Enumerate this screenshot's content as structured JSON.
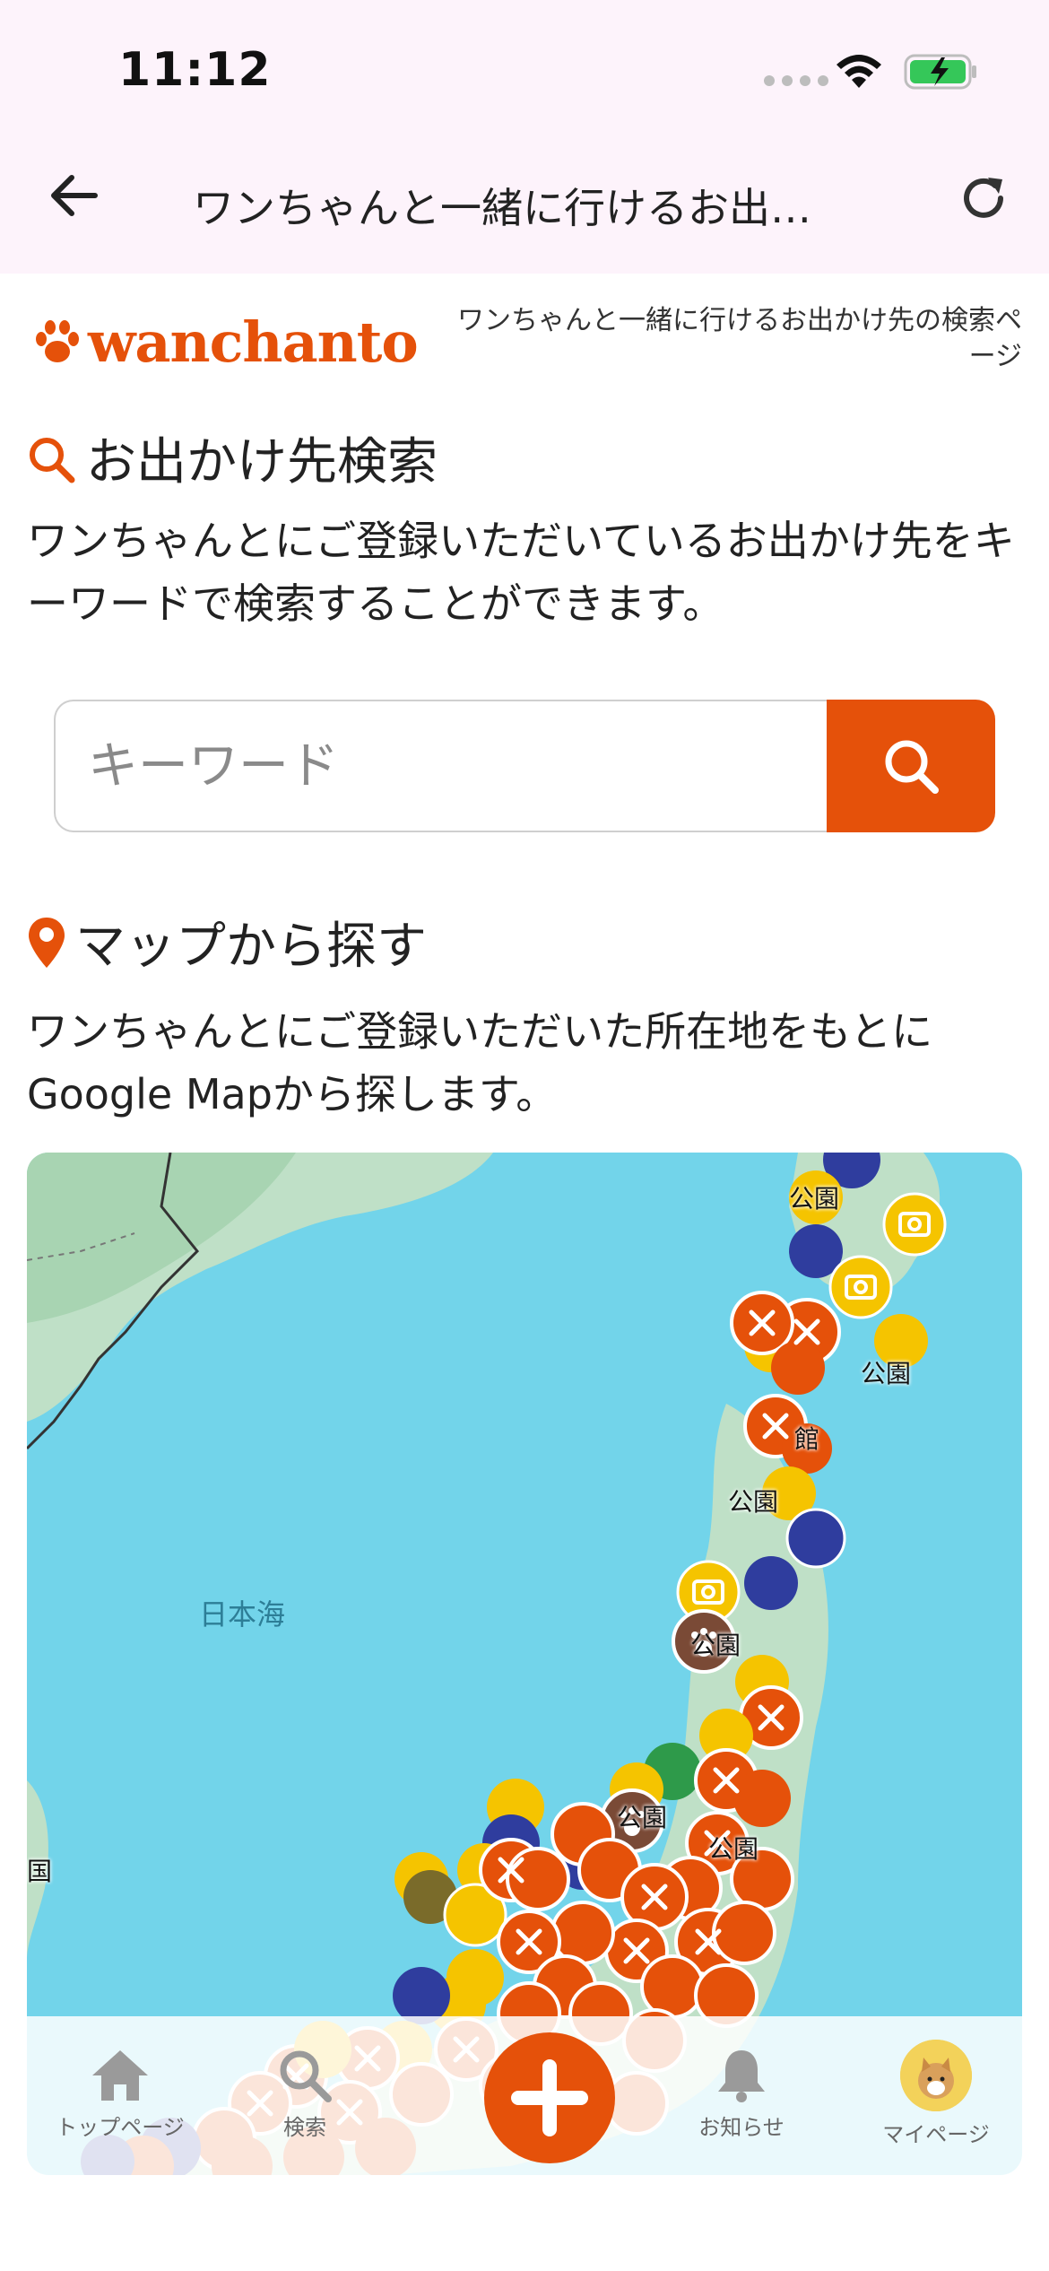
{
  "status_bar": {
    "time": "11:12"
  },
  "nav": {
    "title": "ワンちゃんと一緒に行けるお出…"
  },
  "header": {
    "logo": "wanchanto",
    "tagline": "ワンちゃんと一緒に行けるお出かけ先の検索ページ"
  },
  "search_section": {
    "title": "お出かけ先検索",
    "description": "ワンちゃんとにご登録いただいているお出かけ先をキーワードで検索することができます。",
    "placeholder": "キーワード"
  },
  "map_section": {
    "title": "マップから探す",
    "description": "ワンちゃんとにご登録いただいた所在地をもとにGoogle Mapから探します。",
    "sea_label": "日本海",
    "pin_labels": [
      "公園",
      "公園",
      "館",
      "公園",
      "公園",
      "公園",
      "公園",
      "国"
    ]
  },
  "tabbar": {
    "home": "トップページ",
    "search": "検索",
    "notifications": "お知らせ",
    "mypage": "マイページ"
  },
  "colors": {
    "accent": "#e5510a",
    "nav_bg": "#fdf3fb",
    "sea": "#72d4ea",
    "land": "#bfe0c7"
  }
}
